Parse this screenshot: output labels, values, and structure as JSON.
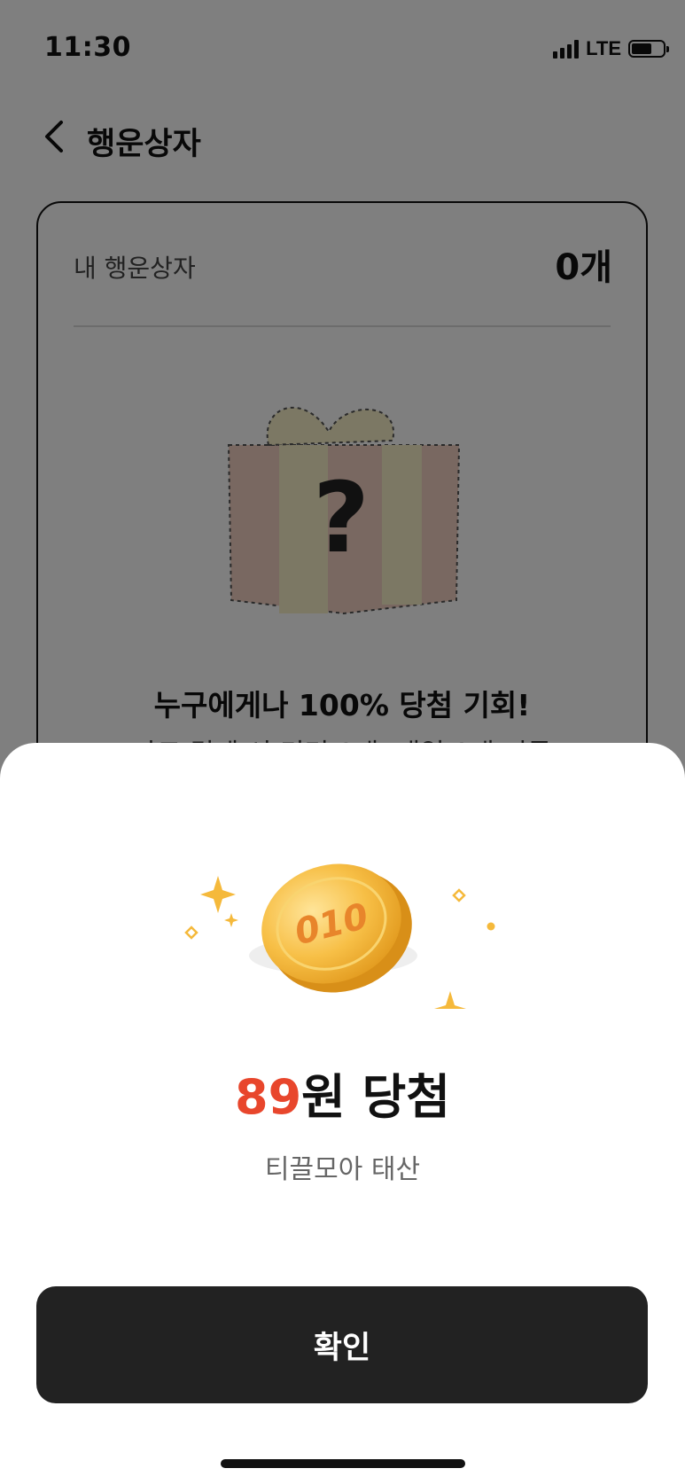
{
  "status_bar": {
    "time": "11:30",
    "network": "LTE",
    "battery_level": 0.58
  },
  "nav": {
    "title": "행운상자",
    "back_icon": "chevron-left-icon"
  },
  "card": {
    "label": "내 행운상자",
    "count": "0개",
    "promo": "누구에게나 100% 당첨 기회!",
    "description": "카드 결제 시 미터 1개, 매일 1개 지급"
  },
  "sheet": {
    "coin_label": "010",
    "result_amount": "89",
    "result_suffix": "원 당첨",
    "subtitle": "티끌모아 태산",
    "confirm_label": "확인"
  },
  "colors": {
    "accent": "#e8462c",
    "button": "#222222",
    "coin": "#f5b93b",
    "dim": "rgba(0,0,0,0.5)"
  }
}
